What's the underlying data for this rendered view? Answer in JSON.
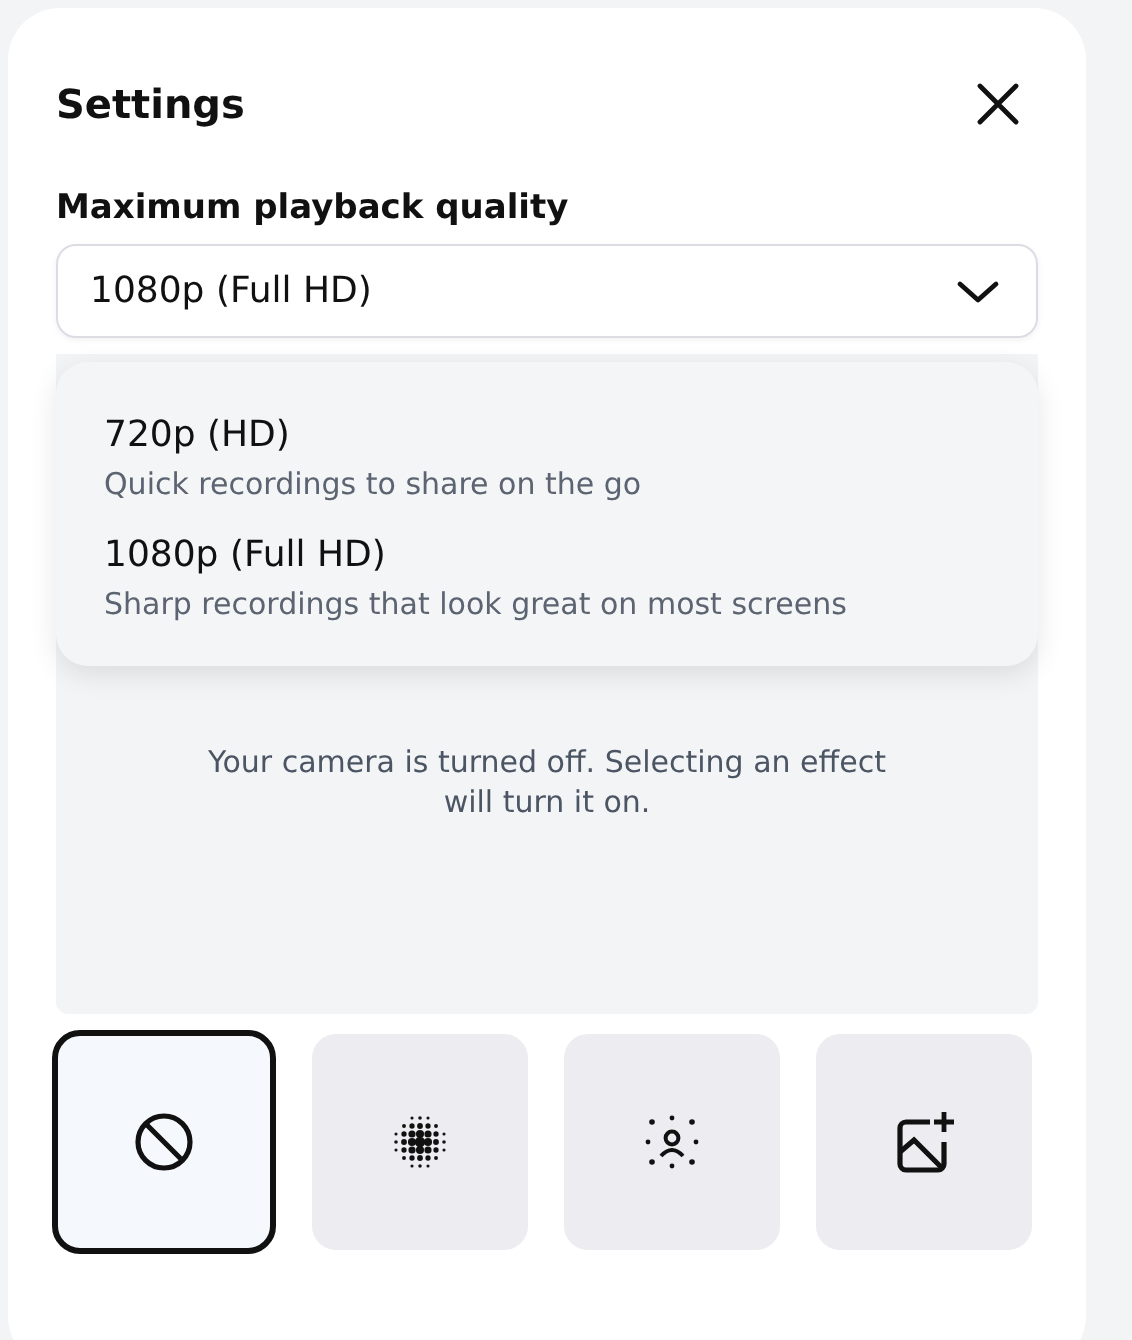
{
  "title": "Settings",
  "quality": {
    "label": "Maximum playback quality",
    "value": "1080p (Full HD)",
    "expanded": true,
    "options": [
      {
        "label": "720p (HD)",
        "description": "Quick recordings to share on the go"
      },
      {
        "label": "1080p (Full HD)",
        "description": "Sharp recordings that look great on most screens"
      }
    ]
  },
  "camera_notice": "Your camera is turned off. Selecting an effect will turn it on.",
  "effects": [
    {
      "kind": "none",
      "selected": true
    },
    {
      "kind": "blur",
      "selected": false
    },
    {
      "kind": "portrait",
      "selected": false
    },
    {
      "kind": "image",
      "selected": false
    }
  ]
}
